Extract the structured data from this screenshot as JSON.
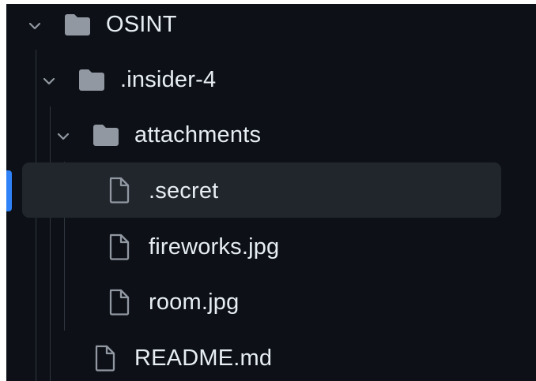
{
  "tree": {
    "items": [
      {
        "label": "OSINT",
        "kind": "folder",
        "expanded": true,
        "depth": 0,
        "icon": "folder-icon",
        "chevron": "chevron-down-icon"
      },
      {
        "label": ".insider-4",
        "kind": "folder",
        "expanded": true,
        "depth": 1,
        "icon": "folder-icon",
        "chevron": "chevron-down-icon"
      },
      {
        "label": "attachments",
        "kind": "folder",
        "expanded": true,
        "depth": 2,
        "icon": "folder-icon",
        "chevron": "chevron-down-icon"
      },
      {
        "label": ".secret",
        "kind": "file",
        "depth": 3,
        "selected": true,
        "icon": "file-icon"
      },
      {
        "label": "fireworks.jpg",
        "kind": "file",
        "depth": 3,
        "icon": "file-icon"
      },
      {
        "label": "room.jpg",
        "kind": "file",
        "depth": 3,
        "icon": "file-icon"
      },
      {
        "label": "README.md",
        "kind": "file",
        "depth": 2,
        "icon": "file-icon"
      }
    ]
  },
  "colors": {
    "background": "#0d1117",
    "text": "#e6edf3",
    "icon": "#9198a1",
    "selected_row": "#21262d",
    "active_indicator": "#2f81f7",
    "guide_line": "#30363d"
  }
}
